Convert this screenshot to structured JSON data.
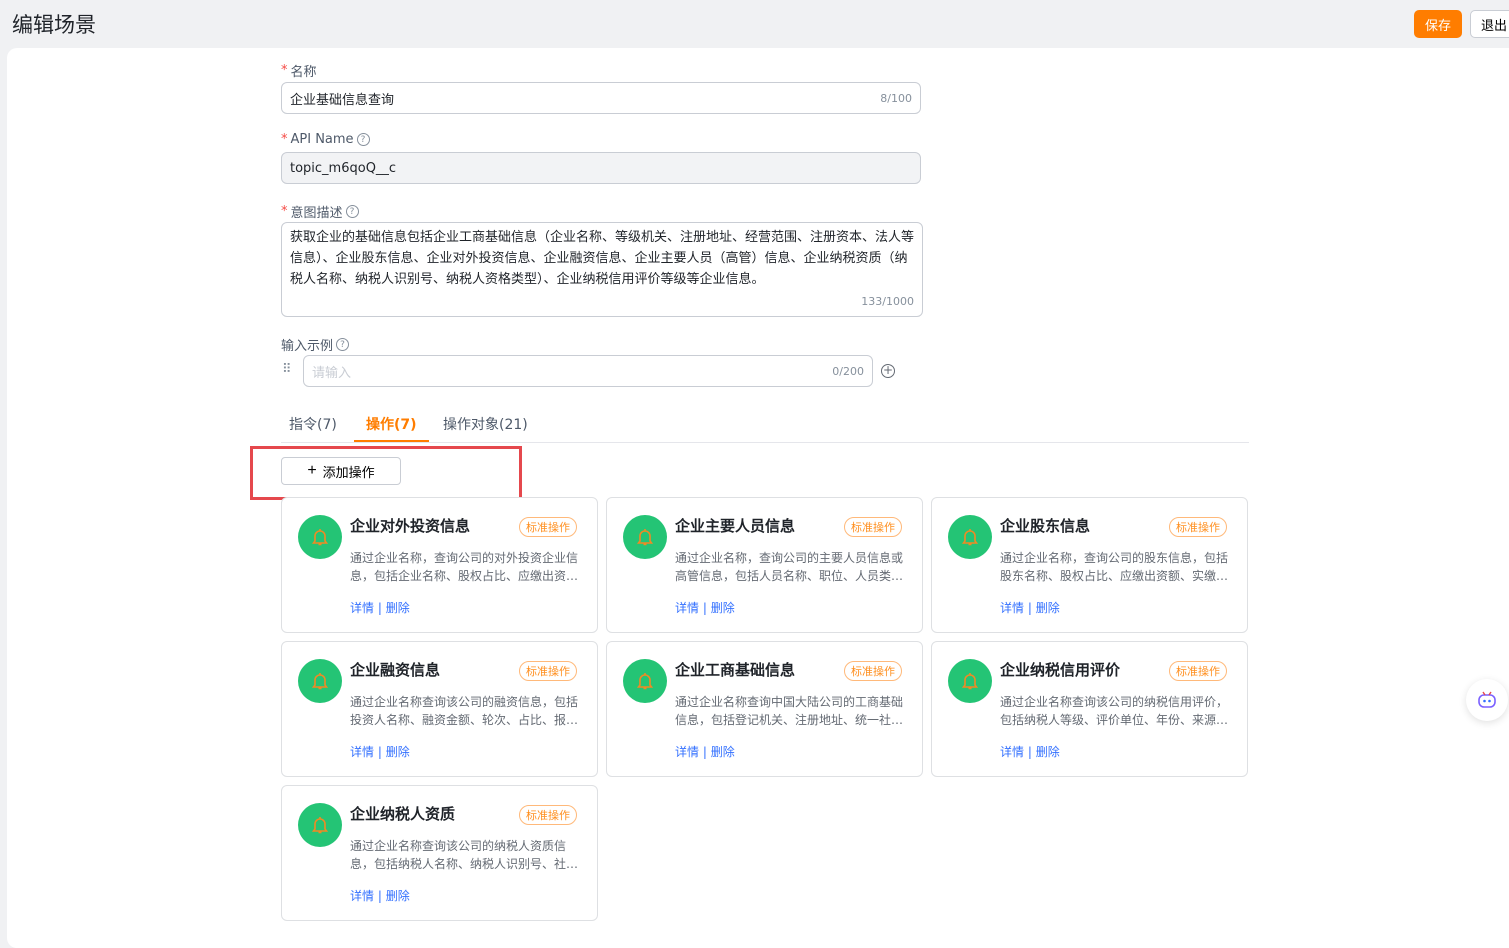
{
  "header": {
    "title": "编辑场景",
    "save": "保存",
    "exit": "退出"
  },
  "form": {
    "name_label": "名称",
    "name_value": "企业基础信息查询",
    "name_count": "8/100",
    "api_label": "API Name",
    "api_value": "topic_m6qoQ__c",
    "intent_label": "意图描述",
    "intent_value": "获取企业的基础信息包括企业工商基础信息（企业名称、等级机关、注册地址、经营范围、注册资本、法人等信息）、企业股东信息、企业对外投资信息、企业融资信息、企业主要人员（高管）信息、企业纳税资质（纳税人名称、纳税人识别号、纳税人资格类型）、企业纳税信用评价等级等企业信息。",
    "intent_count": "133/1000",
    "example_label": "输入示例",
    "example_placeholder": "请输入",
    "example_count": "0/200"
  },
  "tabs": [
    "指令(7)",
    "操作(7)",
    "操作对象(21)"
  ],
  "add_label": "添加操作",
  "cards": [
    {
      "title": "企业对外投资信息",
      "tag": "标准操作",
      "desc": "通过企业名称，查询公司的对外投资企业信息，包括企业名称、股权占比、应缴出资额等信息",
      "detail": "详情",
      "del": "删除"
    },
    {
      "title": "企业主要人员信息",
      "tag": "标准操作",
      "desc": "通过企业名称，查询公司的主要人员信息或高管信息，包括人员名称、职位、人员类型等信息",
      "detail": "详情",
      "del": "删除"
    },
    {
      "title": "企业股东信息",
      "tag": "标准操作",
      "desc": "通过企业名称，查询公司的股东信息，包括股东名称、股权占比、应缴出资额、实缴出资额等信息",
      "detail": "详情",
      "del": "删除"
    },
    {
      "title": "企业融资信息",
      "tag": "标准操作",
      "desc": "通过企业名称查询该公司的融资信息，包括投资人名称、融资金额、轮次、占比、报道时间等信息",
      "detail": "详情",
      "del": "删除"
    },
    {
      "title": "企业工商基础信息",
      "tag": "标准操作",
      "desc": "通过企业名称查询中国大陆公司的工商基础信息，包括登记机关、注册地址、统一社会信用代码等信息",
      "detail": "详情",
      "del": "删除"
    },
    {
      "title": "企业纳税信用评价",
      "tag": "标准操作",
      "desc": "通过企业名称查询该公司的纳税信用评价，包括纳税人等级、评价单位、年份、来源等信息",
      "detail": "详情",
      "del": "删除"
    },
    {
      "title": "企业纳税人资质",
      "tag": "标准操作",
      "desc": "通过企业名称查询该公司的纳税人资质信息，包括纳税人名称、纳税人识别号、社会信用代码等信息",
      "detail": "详情",
      "del": "删除"
    }
  ]
}
